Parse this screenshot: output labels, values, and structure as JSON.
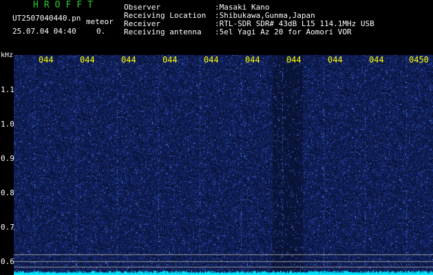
{
  "header": {
    "app_title": "HROFFT",
    "filename": "UT2507040440.pn",
    "mode": "meteor",
    "datetime": "25.07.04 04:40",
    "counter": "0.",
    "info": [
      {
        "label": "Observer",
        "value": ":Masaki Kano"
      },
      {
        "label": "Receiving Location",
        "value": ":Shibukawa,Gunma,Japan"
      },
      {
        "label": "Receiver",
        "value": ":RTL-SDR SDR# 43dB L15 114.1MHz USB"
      },
      {
        "label": "Receiving antenna",
        "value": ":5el Yagi Az 20 for Aomori VOR"
      }
    ]
  },
  "plot": {
    "unit": "kHz",
    "y_ticks": [
      "1.1",
      "1.0",
      "0.9",
      "0.8",
      "0.7",
      "0.6"
    ],
    "time_ticks": [
      "044",
      "044",
      "044",
      "044",
      "044",
      "044",
      "044",
      "044",
      "044",
      "0450"
    ],
    "colors": {
      "background": "#0a0a3a",
      "noise": "#1e2fa8",
      "horizontal_line": "#9a9a9a",
      "baseline": "#00e5ff",
      "time_label": "#ffff00",
      "title": "#2fcf2f"
    }
  }
}
